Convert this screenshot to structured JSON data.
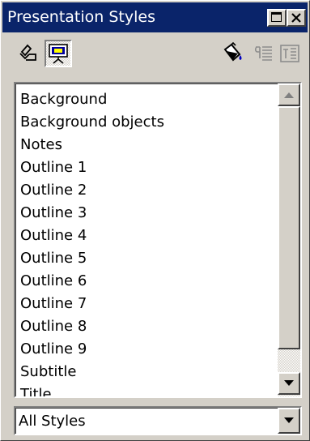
{
  "window": {
    "title": "Presentation Styles",
    "colors": {
      "titlebar": "#0a246a",
      "face": "#d4d0c8"
    }
  },
  "toolbar": {
    "icons": [
      "graphics-styles-icon",
      "presentation-styles-icon",
      "fill-format-mode-icon",
      "new-style-from-selection-icon",
      "update-style-icon"
    ]
  },
  "styles_list": {
    "items": [
      "Background",
      "Background objects",
      "Notes",
      "Outline 1",
      "Outline 2",
      "Outline 3",
      "Outline 4",
      "Outline 5",
      "Outline 6",
      "Outline 7",
      "Outline 8",
      "Outline 9",
      "Subtitle",
      "Title"
    ]
  },
  "filter": {
    "selected": "All Styles"
  }
}
